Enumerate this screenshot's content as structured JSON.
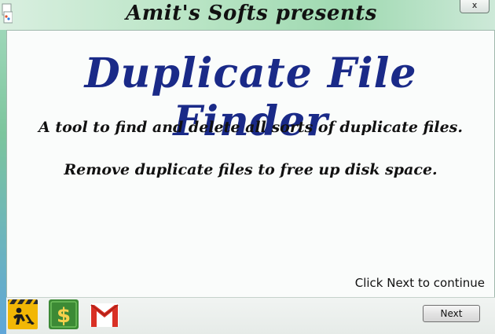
{
  "window": {
    "title": "Amit's Softs presents",
    "close_glyph": "x"
  },
  "main": {
    "heading": "Duplicate File Finder",
    "tagline_1": "A tool to find and delete all sorts of duplicate files.",
    "tagline_2": "Remove duplicate files to free up disk space.",
    "hint": "Click Next to continue"
  },
  "footer": {
    "icons": [
      "construction-worker-icon",
      "money-icon",
      "gmail-icon"
    ],
    "next_label": "Next"
  },
  "colors": {
    "heading": "#1a2a88",
    "gmail_red": "#d93025",
    "money_green": "#3c8a35",
    "construction_yellow": "#f2b705"
  }
}
